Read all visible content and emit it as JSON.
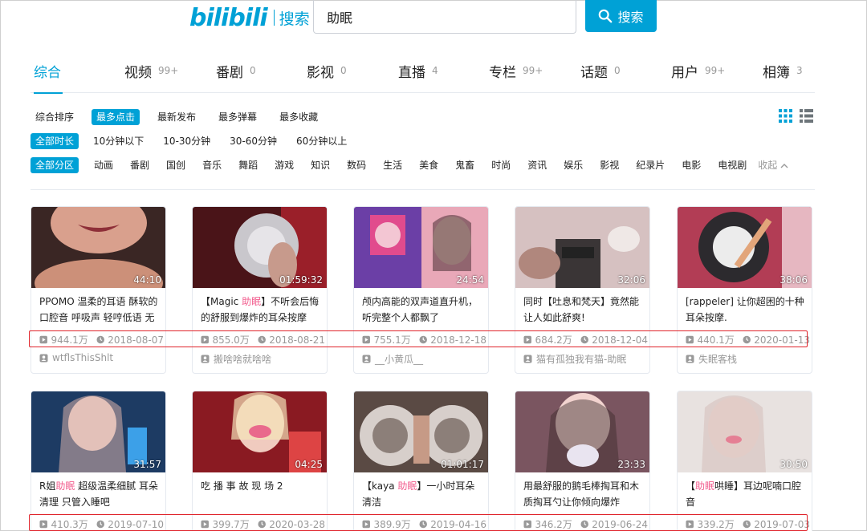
{
  "header": {
    "logo": "bilibili",
    "logo_sub": "搜索",
    "search_value": "助眠",
    "search_button": "搜索"
  },
  "tabs": [
    {
      "label": "综合",
      "count": ""
    },
    {
      "label": "视频",
      "count": "99+"
    },
    {
      "label": "番剧",
      "count": "0"
    },
    {
      "label": "影视",
      "count": "0"
    },
    {
      "label": "直播",
      "count": "4"
    },
    {
      "label": "专栏",
      "count": "99+"
    },
    {
      "label": "话题",
      "count": "0"
    },
    {
      "label": "用户",
      "count": "99+"
    },
    {
      "label": "相簿",
      "count": "3"
    }
  ],
  "sort_options": [
    "综合排序",
    "最多点击",
    "最新发布",
    "最多弹幕",
    "最多收藏"
  ],
  "duration_options": [
    "全部时长",
    "10分钟以下",
    "10-30分钟",
    "30-60分钟",
    "60分钟以上"
  ],
  "category_options": [
    "全部分区",
    "动画",
    "番剧",
    "国创",
    "音乐",
    "舞蹈",
    "游戏",
    "知识",
    "数码",
    "生活",
    "美食",
    "鬼畜",
    "时尚",
    "资讯",
    "娱乐",
    "影视",
    "纪录片",
    "电影",
    "电视剧"
  ],
  "collapse_label": "收起",
  "videos": [
    {
      "title_pre": "PPOMO 温柔的耳语 酥软的口腔音 呼吸声 轻哼低语 无",
      "hl": "",
      "title_post": "",
      "duration": "44:10",
      "views": "944.1万",
      "date": "2018-08-07",
      "uploader": "wtflsThisShlt"
    },
    {
      "title_pre": "【Magic ",
      "hl": "助眠",
      "title_post": "】不听会后悔的舒服到爆炸的耳朵按摩",
      "duration": "01:59:32",
      "views": "855.0万",
      "date": "2018-08-21",
      "uploader": "搬啥啥就啥啥"
    },
    {
      "title_pre": "颅内高能的双声道直升机，听完整个人都飘了",
      "hl": "",
      "title_post": "",
      "duration": "24:54",
      "views": "755.1万",
      "date": "2018-12-18",
      "uploader": "__小黄瓜__"
    },
    {
      "title_pre": "同时【吐息和梵天】竟然能让人如此舒爽!",
      "hl": "",
      "title_post": "",
      "duration": "32:06",
      "views": "684.2万",
      "date": "2018-12-04",
      "uploader": "猫有孤独我有猫-助眠"
    },
    {
      "title_pre": "[rappeler] 让你超困的十种耳朵按摩.",
      "hl": "",
      "title_post": "",
      "duration": "38:06",
      "views": "440.1万",
      "date": "2020-01-13",
      "uploader": "失眠客栈"
    },
    {
      "title_pre": "R姐",
      "hl": "助眠",
      "title_post": " 超级温柔细腻 耳朵清理 只管入睡吧",
      "duration": "31:57",
      "views": "410.3万",
      "date": "2019-07-10",
      "uploader": ""
    },
    {
      "title_pre": "吃 播 事 故 现 场 2",
      "hl": "",
      "title_post": "",
      "duration": "04:25",
      "views": "399.7万",
      "date": "2020-03-28",
      "uploader": ""
    },
    {
      "title_pre": "【kaya ",
      "hl": "助眠",
      "title_post": "】一小时耳朵清洁",
      "duration": "01:01:17",
      "views": "389.9万",
      "date": "2019-04-16",
      "uploader": ""
    },
    {
      "title_pre": "用最舒服的鹅毛棒掏耳和木质掏耳勺让你倾向爆炸",
      "hl": "",
      "title_post": "",
      "duration": "23:33",
      "views": "346.2万",
      "date": "2019-06-24",
      "uploader": ""
    },
    {
      "title_pre": "【",
      "hl": "助眠",
      "title_post": "哄睡】耳边呢喃口腔音",
      "duration": "30:50",
      "views": "339.2万",
      "date": "2019-07-03",
      "uploader": ""
    }
  ],
  "colors": {
    "accent": "#00a1d6",
    "highlight": "#f25d8e",
    "annotation": "#e0242b"
  }
}
